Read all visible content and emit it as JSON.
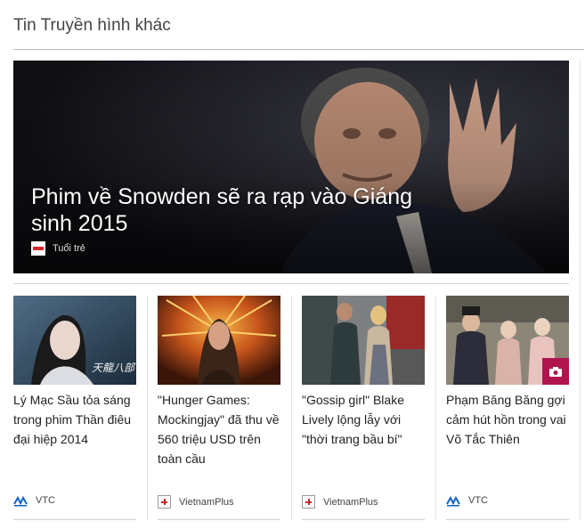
{
  "section": {
    "title": "Tin Truyền hình khác"
  },
  "hero": {
    "title": "Phim về Snowden sẽ ra rạp vào Giáng sinh 2015",
    "source": "Tuổi trẻ"
  },
  "cards": [
    {
      "headline": "Lý Mạc Sầu tỏa sáng trong phim Thần điêu đại hiệp 2014",
      "source": "VTC",
      "icon": "vtc-logo-icon",
      "thumb_text": "天龍八部"
    },
    {
      "headline": "\"Hunger Games: Mockingjay\" đã thu về 560 triệu USD trên toàn cầu",
      "source": "VietnamPlus",
      "icon": "vietnamplus-logo-icon"
    },
    {
      "headline": "\"Gossip girl\" Blake Lively lộng lẫy với \"thời trang bầu bí\"",
      "source": "VietnamPlus",
      "icon": "vietnamplus-logo-icon"
    },
    {
      "headline": "Phạm Băng Băng gợi cảm hút hồn trong vai Võ Tắc Thiên",
      "source": "VTC",
      "icon": "vtc-logo-icon",
      "badge": "camera-icon"
    }
  ],
  "colors": {
    "accent_badge": "#b0154e",
    "tuoitre_red": "#d7262c",
    "vtc_blue": "#1565c0",
    "vietnamplus_red": "#c62828"
  }
}
